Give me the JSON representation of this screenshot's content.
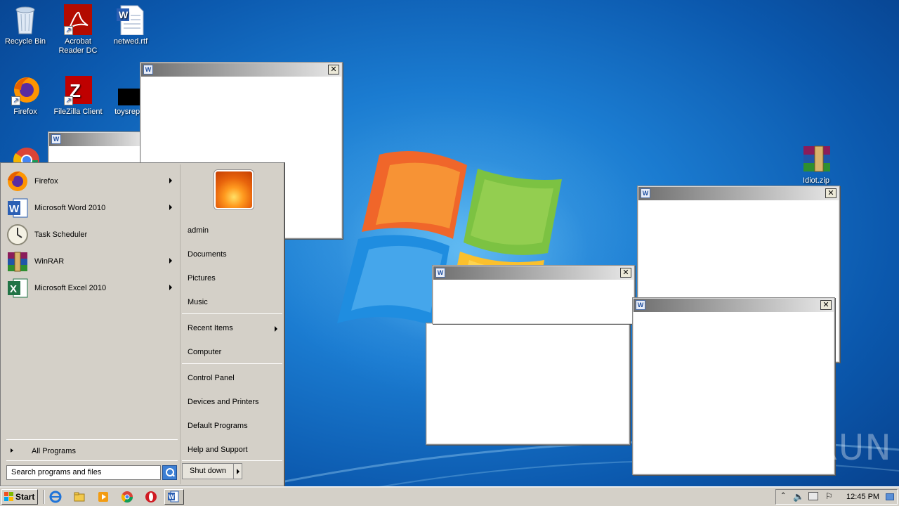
{
  "desktop": {
    "icons": [
      {
        "label": "Recycle Bin"
      },
      {
        "label": "Acrobat\nReader DC"
      },
      {
        "label": "netwed.rtf"
      },
      {
        "label": "Firefox"
      },
      {
        "label": "FileZilla Client"
      },
      {
        "label": "toysrepor"
      },
      {
        "label": "Idiot.zip"
      }
    ]
  },
  "windows": {
    "title_icon": "W",
    "close_glyph": "✕"
  },
  "start_menu": {
    "programs": [
      {
        "label": "Firefox",
        "has_arrow": true
      },
      {
        "label": "Microsoft Word 2010",
        "has_arrow": true
      },
      {
        "label": "Task Scheduler",
        "has_arrow": false
      },
      {
        "label": "WinRAR",
        "has_arrow": true
      },
      {
        "label": "Microsoft Excel 2010",
        "has_arrow": true
      }
    ],
    "all_programs": "All Programs",
    "search_placeholder": "Search programs and files",
    "right_links": {
      "user": "admin",
      "documents": "Documents",
      "pictures": "Pictures",
      "music": "Music",
      "recent_items": "Recent Items",
      "computer": "Computer",
      "control_panel": "Control Panel",
      "devices_printers": "Devices and Printers",
      "default_programs": "Default Programs",
      "help_support": "Help and Support"
    },
    "shutdown_label": "Shut down"
  },
  "taskbar": {
    "start_label": "Start",
    "clock": "12:45 PM"
  },
  "watermark": "ANY RUN"
}
